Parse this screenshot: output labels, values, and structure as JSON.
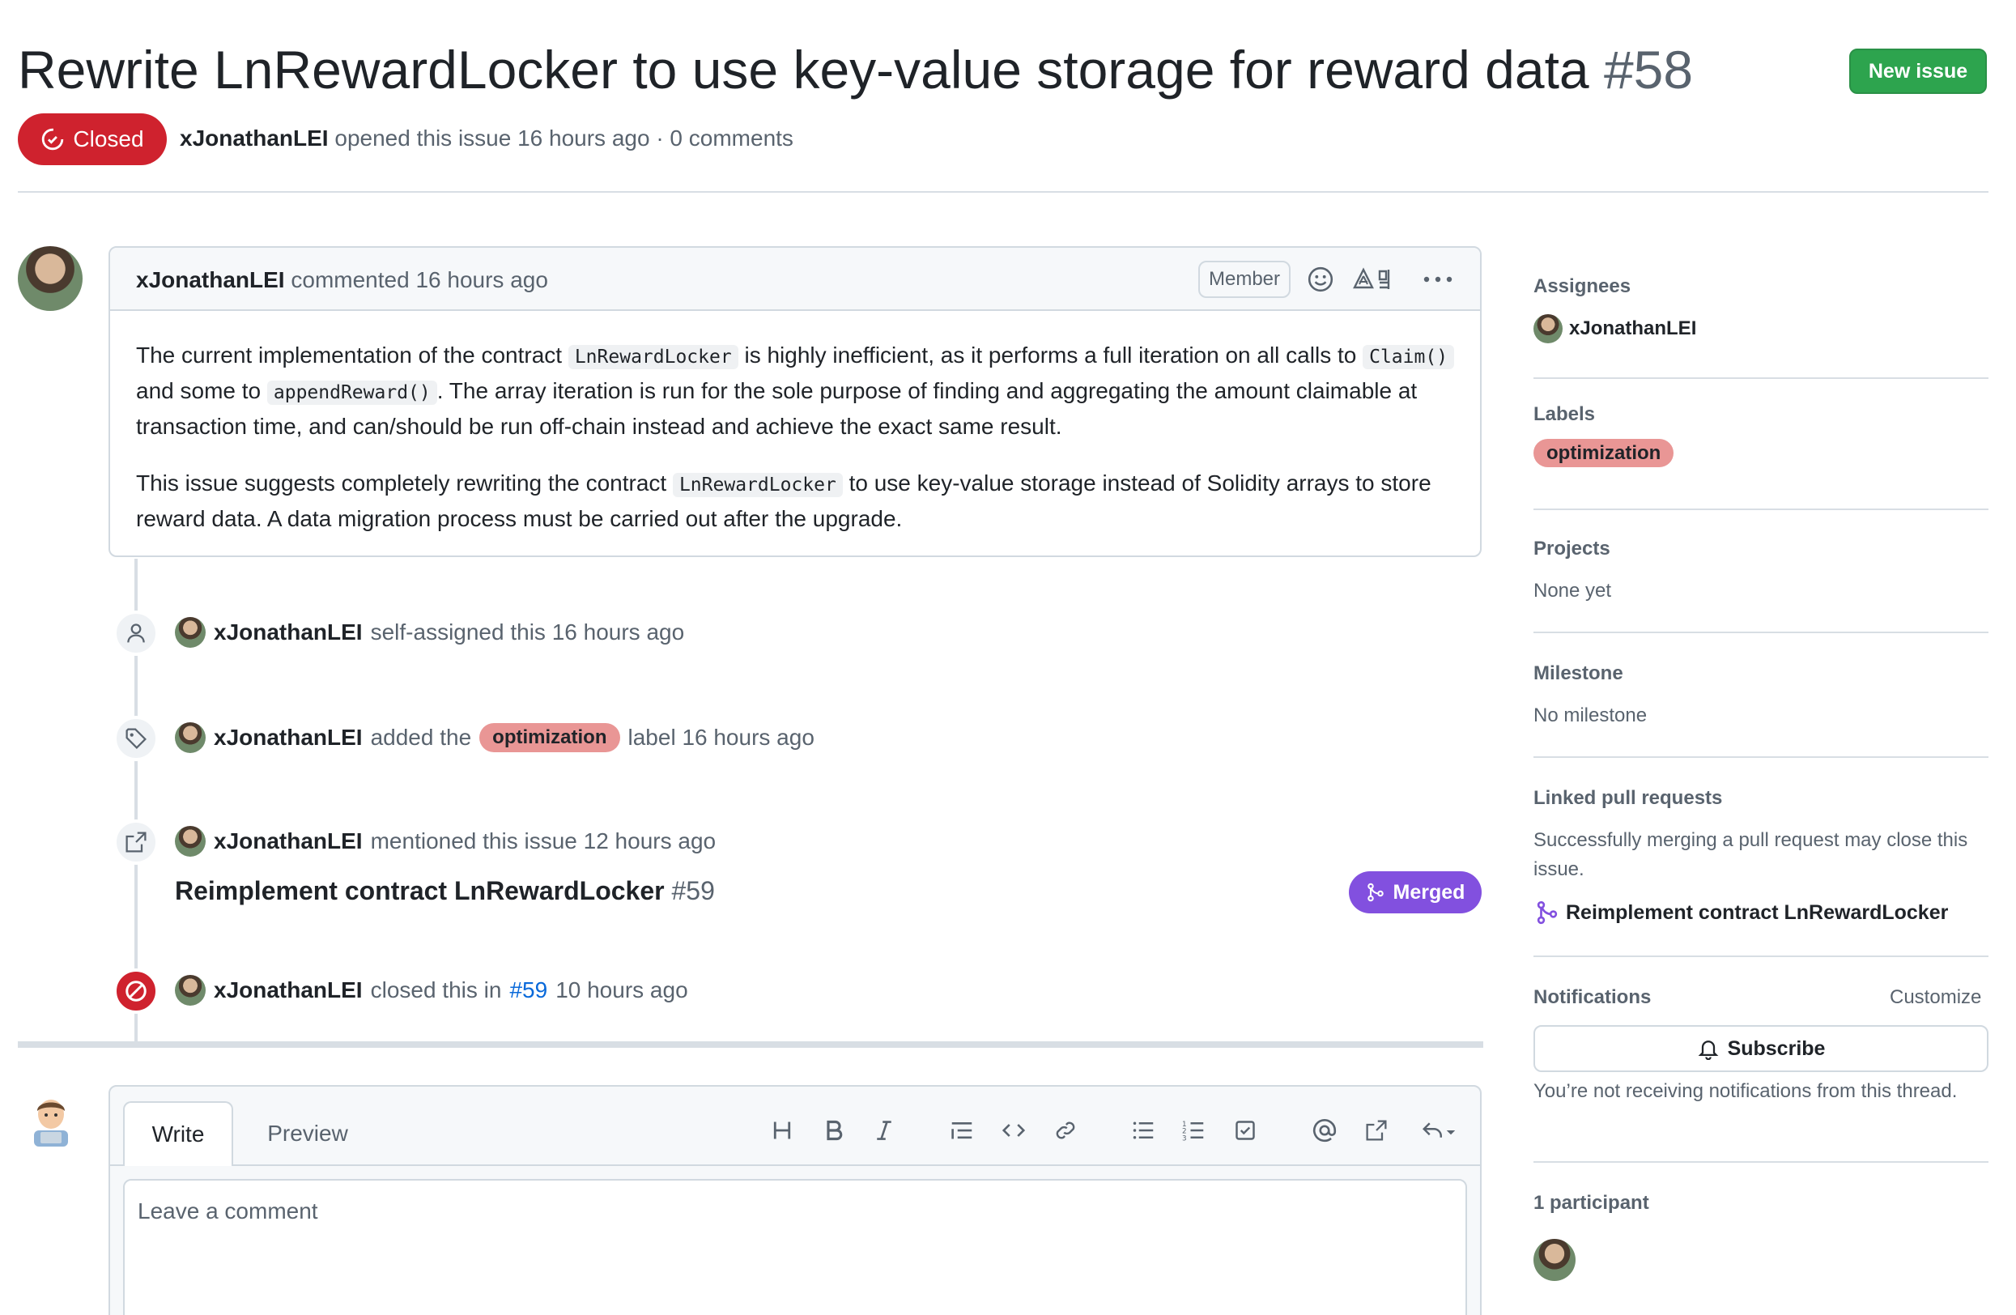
{
  "issue": {
    "title": "Rewrite LnRewardLocker to use key-value storage for reward data",
    "number": "#58",
    "state": "Closed",
    "author": "xJonathanLEI",
    "meta": "opened this issue 16 hours ago · 0 comments"
  },
  "header": {
    "new_issue_label": "New issue"
  },
  "comment": {
    "author": "xJonathanLEI",
    "action": "commented 16 hours ago",
    "role_badge": "Member",
    "p1": [
      "The current implementation of the contract ",
      "LnRewardLocker",
      " is highly inefficient, as it performs a full iteration on all calls to ",
      "Claim()",
      " and some to ",
      "appendReward()",
      ". The array iteration is run for the sole purpose of finding and aggregating the amount claimable at transaction time, and can/should be run off-chain instead and achieve the exact same result."
    ],
    "p2": [
      "This issue suggests completely rewriting the contract ",
      "LnRewardLocker",
      " to use key-value storage instead of Solidity arrays to store reward data. A data migration process must be carried out after the upgrade."
    ]
  },
  "timeline": {
    "assigned": {
      "user": "xJonathanLEI",
      "text": "self-assigned this 16 hours ago"
    },
    "labeled": {
      "user": "xJonathanLEI",
      "pre": "added the",
      "label": "optimization",
      "post": "label 16 hours ago"
    },
    "mentioned": {
      "user": "xJonathanLEI",
      "text": "mentioned this issue 12 hours ago",
      "pr_title": "Reimplement contract LnRewardLocker",
      "pr_number": "#59",
      "pr_state": "Merged"
    },
    "closed": {
      "user": "xJonathanLEI",
      "pre": "closed this in",
      "link": "#59",
      "post": "10 hours ago"
    }
  },
  "form": {
    "tab_write": "Write",
    "tab_preview": "Preview",
    "placeholder": "Leave a comment",
    "toolbar": [
      "heading-icon",
      "bold-icon",
      "italic-icon",
      "quote-icon",
      "code-icon",
      "link-icon",
      "bulleted-list-icon",
      "numbered-list-icon",
      "task-list-icon",
      "mention-icon",
      "cross-reference-icon",
      "saved-reply-icon"
    ]
  },
  "sidebar": {
    "assignees": {
      "heading": "Assignees",
      "user": "xJonathanLEI"
    },
    "labels": {
      "heading": "Labels",
      "label": "optimization"
    },
    "projects": {
      "heading": "Projects",
      "value": "None yet"
    },
    "milestone": {
      "heading": "Milestone",
      "value": "No milestone"
    },
    "linked_prs": {
      "heading": "Linked pull requests",
      "note": "Successfully merging a pull request may close this issue.",
      "pr": "Reimplement contract LnRewardLocker"
    },
    "notifications": {
      "heading": "Notifications",
      "customize": "Customize",
      "subscribe": "Subscribe",
      "note": "You’re not receiving notifications from this thread."
    },
    "participants": {
      "heading": "1 participant"
    }
  },
  "colors": {
    "closed": "#cf222e",
    "merged": "#8250df",
    "label_optimization": "#e99695",
    "new_issue": "#2da44e",
    "link": "#0969da"
  }
}
